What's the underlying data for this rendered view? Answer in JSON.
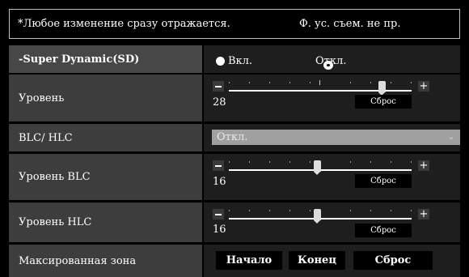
{
  "notice": {
    "text": "*Любое изменение сразу отражается.",
    "aux": "Ф. ус. съем. не пр."
  },
  "super_dynamic": {
    "label": "-Super Dynamic(SD)",
    "on_label": "Вкл.",
    "off_label": "Откл.",
    "selected": "off"
  },
  "level": {
    "label": "Уровень",
    "value": "28",
    "reset": "Сброс"
  },
  "blc_hlc": {
    "label": "BLC/ HLC",
    "selected": "Откл."
  },
  "blc_level": {
    "label": "Уровень BLC",
    "value": "16",
    "reset": "Сброс"
  },
  "hlc_level": {
    "label": "Уровень HLC",
    "value": "16",
    "reset": "Сброс"
  },
  "mask_zone": {
    "label": "Максированная зона",
    "start": "Начало",
    "end": "Конец",
    "reset": "Сброс"
  },
  "icons": {
    "minus": "minus-icon",
    "plus": "plus-icon",
    "chevron": "chevron-down-icon"
  }
}
